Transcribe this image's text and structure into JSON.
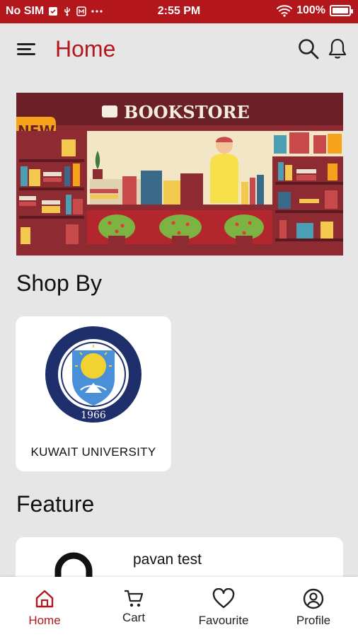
{
  "status_bar": {
    "carrier": "No SIM",
    "time": "2:55 PM",
    "battery": "100%"
  },
  "header": {
    "title": "Home",
    "icons": [
      "menu-icon",
      "search-icon",
      "bell-icon"
    ]
  },
  "banner": {
    "heading": "BOOKSTORE",
    "badge": "NEW"
  },
  "shop_by": {
    "title": "Shop By",
    "items": [
      {
        "label": "KUWAIT UNIVERSITY",
        "logo_year": "1966"
      }
    ]
  },
  "feature": {
    "title": "Feature",
    "items": [
      {
        "title": "pavan test"
      }
    ]
  },
  "bottom_nav": {
    "items": [
      {
        "label": "Home",
        "icon": "home-icon",
        "active": true
      },
      {
        "label": "Cart",
        "icon": "cart-icon",
        "active": false
      },
      {
        "label": "Favourite",
        "icon": "heart-icon",
        "active": false
      },
      {
        "label": "Profile",
        "icon": "profile-icon",
        "active": false
      }
    ]
  },
  "colors": {
    "brand": "#b3161b",
    "background": "#e6e6e6",
    "card": "#ffffff"
  }
}
